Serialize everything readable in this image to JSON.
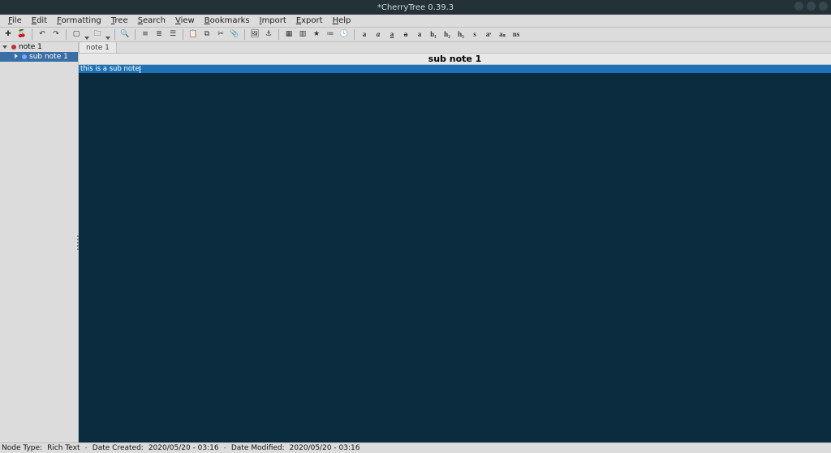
{
  "window": {
    "title": "*CherryTree 0.39.3"
  },
  "menu": {
    "items": [
      "File",
      "Edit",
      "Formatting",
      "Tree",
      "Search",
      "View",
      "Bookmarks",
      "Import",
      "Export",
      "Help"
    ]
  },
  "toolbar": {
    "icons": [
      "new-node",
      "cherry",
      "sep",
      "undo",
      "redo",
      "sep",
      "new-instance",
      "dropdown",
      "open",
      "dropdown",
      "sep",
      "find",
      "sep",
      "list-bullet",
      "list-number",
      "list-todo",
      "sep",
      "paste",
      "copy",
      "cut",
      "attach",
      "sep",
      "image",
      "anchor",
      "sep",
      "table",
      "codebox",
      "insert-special",
      "insert-toc",
      "insert-timestamp",
      "sep",
      "bold",
      "italic",
      "underline",
      "strike",
      "mono",
      "h1",
      "h2",
      "h3",
      "small",
      "superscript",
      "subscript",
      "remove-format"
    ],
    "glyph": {
      "new-node": "✚",
      "cherry": "🍒",
      "undo": "↶",
      "redo": "↷",
      "new-instance": "▢",
      "open": "🗀",
      "find": "🔍",
      "list-bullet": "≡",
      "list-number": "≣",
      "list-todo": "☰",
      "paste": "📋",
      "copy": "⧉",
      "cut": "✂",
      "attach": "📎",
      "image": "🖼",
      "anchor": "⚓",
      "table": "▦",
      "codebox": "▥",
      "insert-special": "★",
      "insert-toc": "≔",
      "insert-timestamp": "🕓",
      "bold": "a",
      "italic": "a",
      "underline": "a",
      "strike": "a",
      "mono": "a",
      "h1": "h₁",
      "h2": "h₂",
      "h3": "h₃",
      "small": "s",
      "superscript": "aˢ",
      "subscript": "aₛ",
      "remove-format": "ns"
    }
  },
  "tree": {
    "rows": [
      {
        "label": "note 1",
        "depth": 0,
        "selected": false,
        "expand": "d",
        "bullet": "root"
      },
      {
        "label": "sub note 1",
        "depth": 1,
        "selected": true,
        "expand": "r",
        "bullet": "sub"
      }
    ]
  },
  "tabs": {
    "inactive": "note 1"
  },
  "header": {
    "title": "sub note 1"
  },
  "editor": {
    "line1": "this is a sub note"
  },
  "status": {
    "node_type_label": "Node Type:",
    "node_type_value": "Rich Text",
    "created_label": "Date Created:",
    "created_value": "2020/05/20 - 03:16",
    "modified_label": "Date Modified:",
    "modified_value": "2020/05/20 - 03:16"
  }
}
